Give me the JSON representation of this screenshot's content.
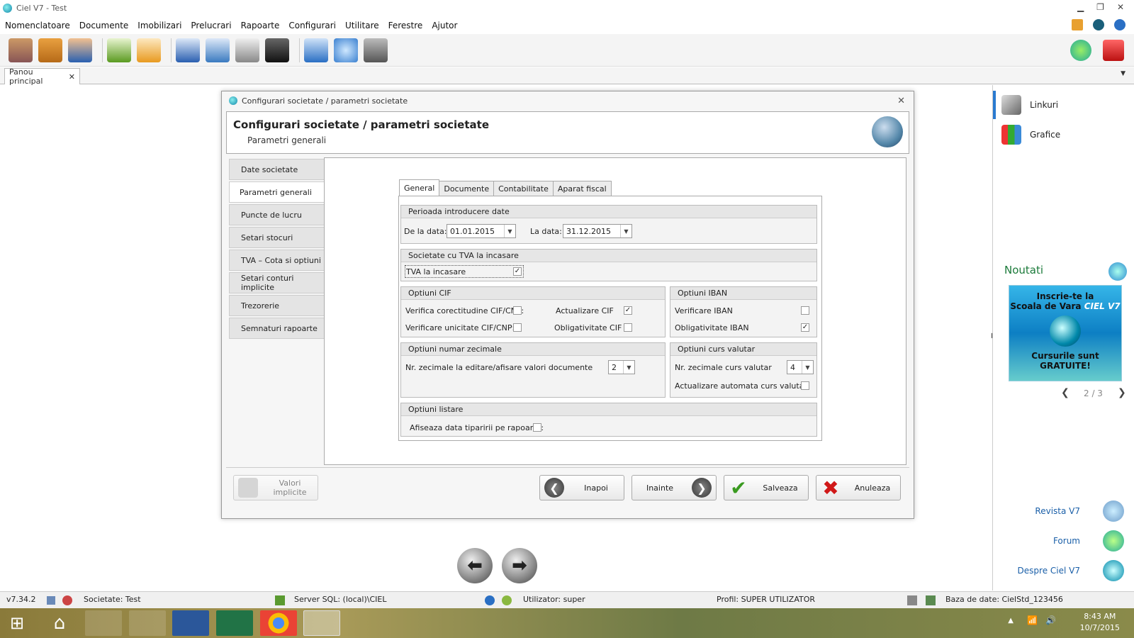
{
  "window": {
    "title": "Ciel V7 - Test"
  },
  "menu": [
    "Nomenclatoare",
    "Documente",
    "Imobilizari",
    "Prelucrari",
    "Rapoarte",
    "Configurari",
    "Utilitare",
    "Ferestre",
    "Ajutor"
  ],
  "tab": {
    "label": "Panou principal",
    "close": "✕"
  },
  "dialog": {
    "title": "Configurari societate / parametri societate",
    "heading": "Configurari societate / parametri societate",
    "subheading": "Parametri generali",
    "close": "✕"
  },
  "nav": [
    "Date societate",
    "Parametri generali",
    "Puncte de lucru",
    "Setari stocuri",
    "TVA – Cota si optiuni",
    "Setari conturi implicite",
    "Trezorerie",
    "Semnaturi rapoarte"
  ],
  "tabs": [
    "General",
    "Documente",
    "Contabilitate",
    "Aparat fiscal"
  ],
  "period": {
    "title": "Perioada introducere date",
    "from_label": "De la data:",
    "from": "01.01.2015",
    "to_label": "La data:",
    "to": "31.12.2015"
  },
  "tva": {
    "title": "Societate cu TVA la incasare",
    "label": "TVA la incasare",
    "checked": "✓"
  },
  "cif": {
    "title": "Optiuni CIF",
    "verif_corect": "Verifica corectitudine CIF/CNP:",
    "verif_unic": "Verificare unicitate CIF/CNP:",
    "actualizare": "Actualizare CIF",
    "actualizare_checked": "✓",
    "obligativitate": "Obligativitate CIF"
  },
  "iban": {
    "title": "Optiuni IBAN",
    "verificare": "Verificare IBAN",
    "obligativitate": "Obligativitate IBAN",
    "obligativitate_checked": "✓"
  },
  "decimals": {
    "title": "Optiuni numar zecimale",
    "label": "Nr. zecimale la editare/afisare valori documente",
    "value": "2"
  },
  "currency": {
    "title": "Optiuni curs valutar",
    "label": "Nr. zecimale curs valutar",
    "value": "4",
    "auto": "Actualizare automata curs valutar"
  },
  "listing": {
    "title": "Optiuni listare",
    "label": "Afiseaza data tiparirii pe rapoarte:"
  },
  "footer": {
    "defaults": "Valori implicite",
    "back": "Inapoi",
    "next": "Inainte",
    "save": "Salveaza",
    "cancel": "Anuleaza"
  },
  "right": {
    "links": "Linkuri",
    "charts": "Grafice",
    "news": "Noutati",
    "ad_line1": "Inscrie-te la",
    "ad_line2": "Scoala de Vara",
    "ad_brand": "CIEL V7",
    "ad_line3": "Cursurile sunt GRATUITE!",
    "pager": "2 / 3",
    "prev": "❮",
    "next": "❯",
    "revista": "Revista V7",
    "forum": "Forum",
    "despre": "Despre Ciel V7"
  },
  "status": {
    "version": "v7.34.2",
    "company": "Societate: Test",
    "server": "Server SQL: (local)\\CIEL",
    "user": "Utilizator: super",
    "profile": "Profil: SUPER UTILIZATOR",
    "db": "Baza de date: CielStd_123456"
  },
  "clock": {
    "time": "8:43 AM",
    "date": "10/7/2015"
  },
  "colors": {
    "accent": "#1a5fa8",
    "news": "#1b7a3a"
  }
}
